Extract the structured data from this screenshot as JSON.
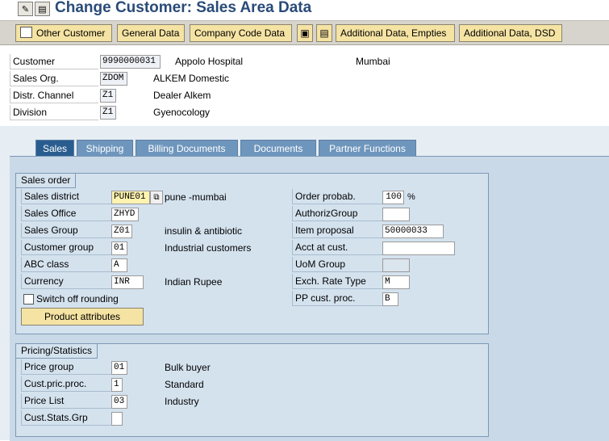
{
  "window": {
    "title": "Change Customer: Sales Area Data"
  },
  "toolbar": {
    "other_customer": "Other Customer",
    "general_data": "General Data",
    "company_code_data": "Company Code Data",
    "additional_empties": "Additional Data, Empties",
    "additional_dsd": "Additional Data, DSD"
  },
  "header": {
    "customer": {
      "label": "Customer",
      "value": "9990000031",
      "name": "Appolo Hospital",
      "city": "Mumbai"
    },
    "sales_org": {
      "label": "Sales Org.",
      "value": "ZDOM",
      "text": "ALKEM Domestic"
    },
    "distr_channel": {
      "label": "Distr. Channel",
      "value": "Z1",
      "text": "Dealer Alkem"
    },
    "division": {
      "label": "Division",
      "value": "Z1",
      "text": "Gyenocology"
    }
  },
  "tabs": [
    "Sales",
    "Shipping",
    "Billing Documents",
    "Documents",
    "Partner Functions"
  ],
  "sales_order": {
    "title": "Sales order",
    "sales_district": {
      "label": "Sales district",
      "value": "PUNE01",
      "text": "pune -mumbai"
    },
    "sales_office": {
      "label": "Sales Office",
      "value": "ZHYD"
    },
    "sales_group": {
      "label": "Sales Group",
      "value": "Z01",
      "text": "insulin & antibiotic"
    },
    "customer_group": {
      "label": "Customer group",
      "value": "01",
      "text": "Industrial customers"
    },
    "abc_class": {
      "label": "ABC class",
      "value": "A"
    },
    "currency": {
      "label": "Currency",
      "value": "INR",
      "text": "Indian Rupee"
    },
    "switch_off_rounding": "Switch off rounding",
    "product_attributes": "Product attributes",
    "order_probab": {
      "label": "Order probab.",
      "value": "100",
      "unit": "%"
    },
    "authoriz_group": {
      "label": "AuthorizGroup",
      "value": ""
    },
    "item_proposal": {
      "label": "Item proposal",
      "value": "50000033"
    },
    "acct_at_cust": {
      "label": "Acct at cust.",
      "value": ""
    },
    "uom_group": {
      "label": "UoM Group",
      "value": ""
    },
    "exch_rate_type": {
      "label": "Exch. Rate Type",
      "value": "M"
    },
    "pp_cust_proc": {
      "label": "PP cust. proc.",
      "value": "B"
    }
  },
  "pricing": {
    "title": "Pricing/Statistics",
    "price_group": {
      "label": "Price group",
      "value": "01",
      "text": "Bulk buyer"
    },
    "cust_pric_proc": {
      "label": "Cust.pric.proc.",
      "value": "1",
      "text": "Standard"
    },
    "price_list": {
      "label": "Price List",
      "value": "03",
      "text": "Industry"
    },
    "cust_stats_grp": {
      "label": "Cust.Stats.Grp",
      "value": ""
    }
  }
}
